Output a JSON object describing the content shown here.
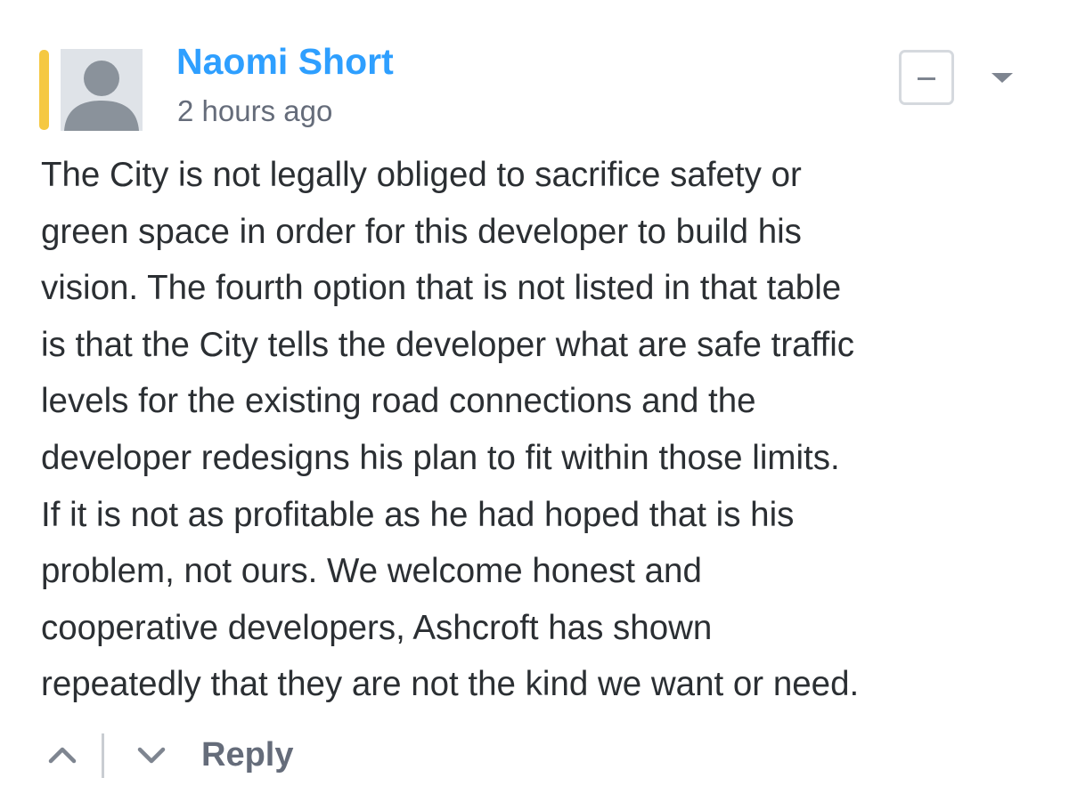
{
  "comment": {
    "author": "Naomi Short",
    "timestamp": "2 hours ago",
    "body_lines": [
      "The City is not legally obliged to sacrifice safety or",
      "green space in order for this developer to build his",
      "vision. The fourth option that is not listed in that table",
      "is that the City tells the developer what are safe traffic",
      "levels for the existing road connections and the",
      "developer redesigns his plan to fit within those limits.",
      "If it is not as profitable as he had hoped that is his",
      "problem, not ours. We welcome honest and",
      "cooperative developers, Ashcroft has shown",
      "repeatedly that they are not the kind we want or need."
    ],
    "reply_label": "Reply"
  },
  "icons": {
    "avatar": "default-user-avatar-icon",
    "collapse": "minus-icon",
    "menu": "caret-down-icon",
    "upvote": "chevron-up-icon",
    "downvote": "chevron-down-icon"
  },
  "colors": {
    "author_name": "#2e9fff",
    "accent_bar": "#f5c842",
    "body_text": "#2b2f33",
    "muted_text": "#656c7a"
  }
}
